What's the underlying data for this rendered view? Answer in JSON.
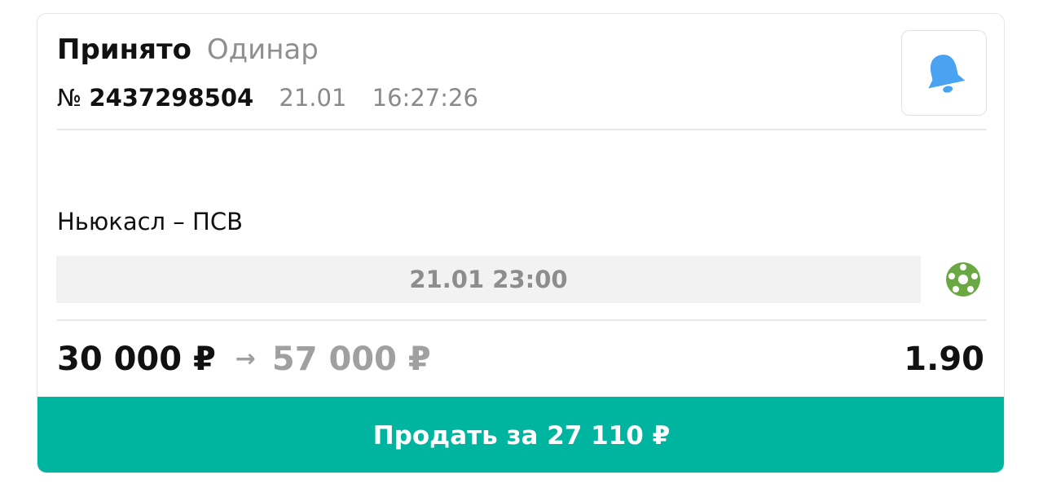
{
  "bet": {
    "status": "Принято",
    "type": "Одинар",
    "number_prefix": "№",
    "number": "2437298504",
    "date": "21.01",
    "time": "16:27:26"
  },
  "icons": {
    "notify": "bell-icon",
    "sport": "soccer-ball-icon"
  },
  "event": {
    "match": "Ньюкасл – ПСВ",
    "start": "21.01 23:00"
  },
  "amounts": {
    "stake": "30 000 ₽",
    "arrow": "→",
    "payout": "57 000 ₽",
    "odds": "1.90"
  },
  "sell_button": {
    "label": "Продать за 27 110 ₽"
  },
  "colors": {
    "accent": "#00b5a0",
    "bell": "#4aa3f0",
    "sport_icon": "#6aa844",
    "muted_text": "#8f8f8f"
  }
}
